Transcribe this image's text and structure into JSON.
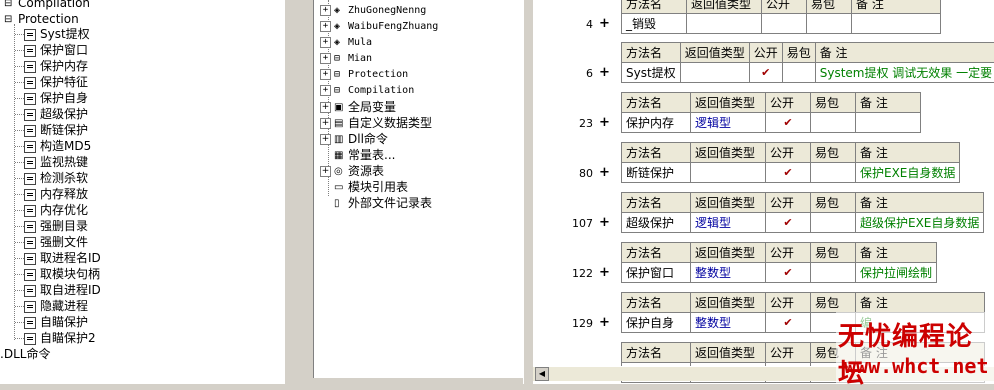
{
  "left_tree": {
    "top_items": [
      "Compilation",
      "Protection"
    ],
    "children": [
      "Syst提权",
      "保护窗口",
      "保护内存",
      "保护特征",
      "保护自身",
      "超级保护",
      "断链保护",
      "构造MD5",
      "监视热键",
      "检测杀软",
      "内存释放",
      "内存优化",
      "强删目录",
      "强删文件",
      "取进程名ID",
      "取模块句柄",
      "取自进程ID",
      "隐藏进程",
      "自瞄保护",
      "自瞄保护2"
    ],
    "bottom_item": "DLL命令"
  },
  "mid_tree": {
    "modules": [
      "ZhuGonegNenng",
      "WaibuFengZhuang",
      "Mula",
      "Mian",
      "Protection",
      "Compilation"
    ],
    "categories": [
      "全局变量",
      "自定义数据类型",
      "Dll命令",
      "常量表...",
      "资源表",
      "模块引用表",
      "外部文件记录表"
    ]
  },
  "right": {
    "header": [
      "方法名",
      "返回值类型",
      "公开",
      "易包",
      "备 注"
    ],
    "methods": [
      {
        "line": "4",
        "name": "_销毁",
        "ret": "",
        "pub": false,
        "note": ""
      },
      {
        "line": "6",
        "name": "Syst提权",
        "ret": "",
        "pub": true,
        "note": "System提权 调试无效果 一定要"
      },
      {
        "line": "23",
        "name": "保护内存",
        "ret": "逻辑型",
        "pub": true,
        "note": ""
      },
      {
        "line": "80",
        "name": "断链保护",
        "ret": "",
        "pub": true,
        "note": "保护EXE自身数据"
      },
      {
        "line": "107",
        "name": "超级保护",
        "ret": "逻辑型",
        "pub": true,
        "note": "超级保护EXE自身数据"
      },
      {
        "line": "122",
        "name": "保护窗口",
        "ret": "整数型",
        "pub": true,
        "note": "保护拉闸绘制"
      },
      {
        "line": "129",
        "name": "保护自身",
        "ret": "整数型",
        "pub": true,
        "note": "编"
      },
      {
        "line": "",
        "name": "",
        "ret": "",
        "pub": false,
        "note": ""
      }
    ],
    "check_mark": "✔",
    "plus": "+"
  },
  "watermark": {
    "line1": "无忧编程论坛",
    "line2": "www.whct.net"
  }
}
